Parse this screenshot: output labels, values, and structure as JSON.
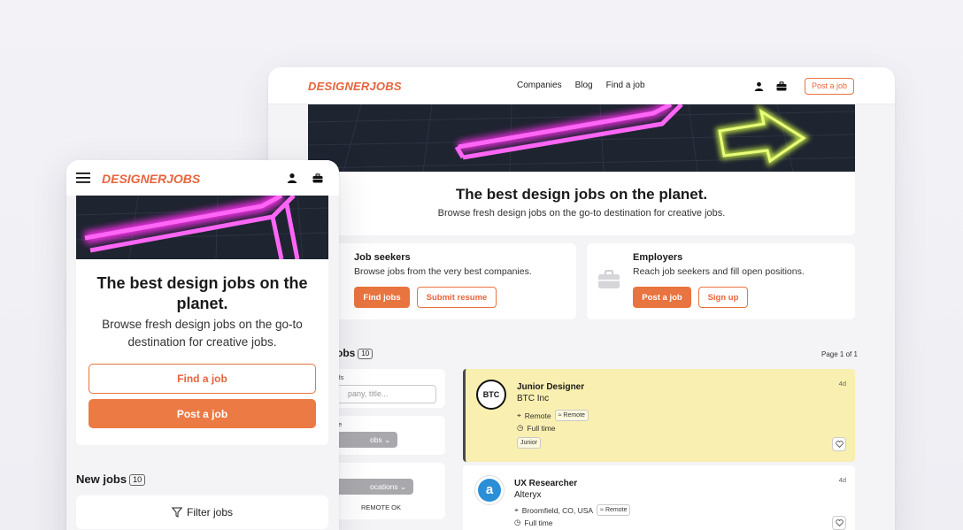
{
  "desktop": {
    "logo": "DESIGNERJOBS",
    "nav_links": [
      "Companies",
      "Blog",
      "Find a job"
    ],
    "post_job_button": "Post a job",
    "hero": {
      "title": "The best design jobs on the planet.",
      "subtitle": "Browse fresh design jobs on the go-to destination for creative jobs."
    },
    "job_seekers": {
      "title": "Job seekers",
      "subtitle": "Browse jobs from the very best companies.",
      "primary_button": "Find jobs",
      "secondary_button": "Submit resume"
    },
    "employers": {
      "title": "Employers",
      "subtitle": "Reach job seekers and fill open positions.",
      "primary_button": "Post a job",
      "secondary_button": "Sign up"
    },
    "jobs_heading": "obs",
    "jobs_count": "10",
    "page_indicator": "Page 1 of 1",
    "filters": {
      "keywords_label": "rds",
      "keywords_placeholder": "pany, title...",
      "type_label": "pe",
      "type_chip": "obs",
      "location_label": "n",
      "location_chip": "ocations",
      "remote_label": "REMOTE OK"
    },
    "jobs": [
      {
        "title": "Junior Designer",
        "company": "BTC Inc",
        "logo_text": "BTC",
        "location": "Remote",
        "remote_tag": "Remote",
        "type": "Full time",
        "level_tag": "Junior",
        "age": "4d"
      },
      {
        "title": "UX Researcher",
        "company": "Alteryx",
        "logo_text": "a",
        "location": "Broomfield, CO, USA",
        "remote_tag": "Remote",
        "type": "Full time",
        "age": "4d"
      }
    ]
  },
  "mobile": {
    "logo": "DESIGNERJOBS",
    "hero_title": "The best design jobs on the planet.",
    "hero_subtitle": "Browse fresh design jobs on the go-to destination for creative jobs.",
    "find_job_button": "Find a job",
    "post_job_button": "Post a job",
    "new_jobs_heading": "New jobs",
    "new_jobs_count": "10",
    "filter_button": "Filter jobs"
  },
  "colors": {
    "brand_orange": "#e8643c",
    "button_orange": "#e8743f",
    "featured_job": "#f9efb0",
    "neon_pink": "#ff3df2",
    "neon_yellow": "#e6ff6a"
  }
}
